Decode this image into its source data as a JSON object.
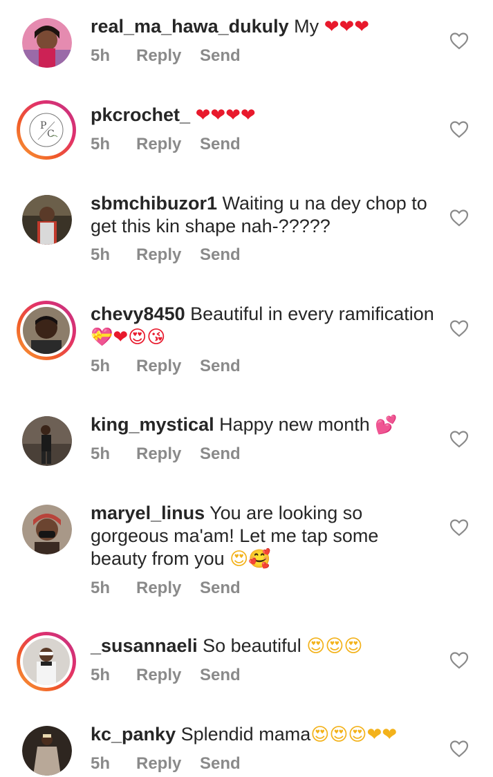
{
  "actions": {
    "reply": "Reply",
    "send": "Send"
  },
  "comments": [
    {
      "username": "real_ma_hawa_dukuly",
      "text": "My",
      "emoji": "❤❤❤",
      "time": "5h",
      "avatar": "portrait-woman-pink",
      "story": false
    },
    {
      "username": "pkcrochet_",
      "text": "",
      "emoji": "❤❤❤❤",
      "time": "5h",
      "avatar": "pk-logo",
      "story": true
    },
    {
      "username": "sbmchibuzor1",
      "text": "Waiting u na dey chop to get this kin shape nah-?????",
      "emoji": "",
      "time": "5h",
      "avatar": "man-outdoor",
      "story": false
    },
    {
      "username": "chevy8450",
      "text": "Beautiful in every ramification",
      "emoji": "💝❤😍😘",
      "time": "5h",
      "avatar": "man-portrait",
      "story": true
    },
    {
      "username": "king_mystical",
      "text": "Happy new month",
      "emoji": "💕",
      "time": "5h",
      "avatar": "man-standing",
      "story": false
    },
    {
      "username": "maryel_linus",
      "text": "You are looking so gorgeous ma'am! Let me tap some beauty from you",
      "emoji": "😍🥰",
      "time": "5h",
      "avatar": "woman-headwrap-mask",
      "story": false
    },
    {
      "username": "_susannaeli",
      "text": "So beautiful",
      "emoji": "😍😍😍",
      "time": "5h",
      "avatar": "woman-white-outfit",
      "story": true
    },
    {
      "username": "kc_panky",
      "text": "Splendid mama",
      "emoji": "😍😍😍❤❤",
      "time": "5h",
      "avatar": "woman-dark-dress",
      "story": false
    }
  ],
  "colors": {
    "text": "#262626",
    "meta": "#8a8a8a",
    "heart": "#e8192c",
    "story_ring_start": "#f9a13a",
    "story_ring_end": "#c13584"
  },
  "icons": {
    "like": "heart-outline-icon"
  }
}
